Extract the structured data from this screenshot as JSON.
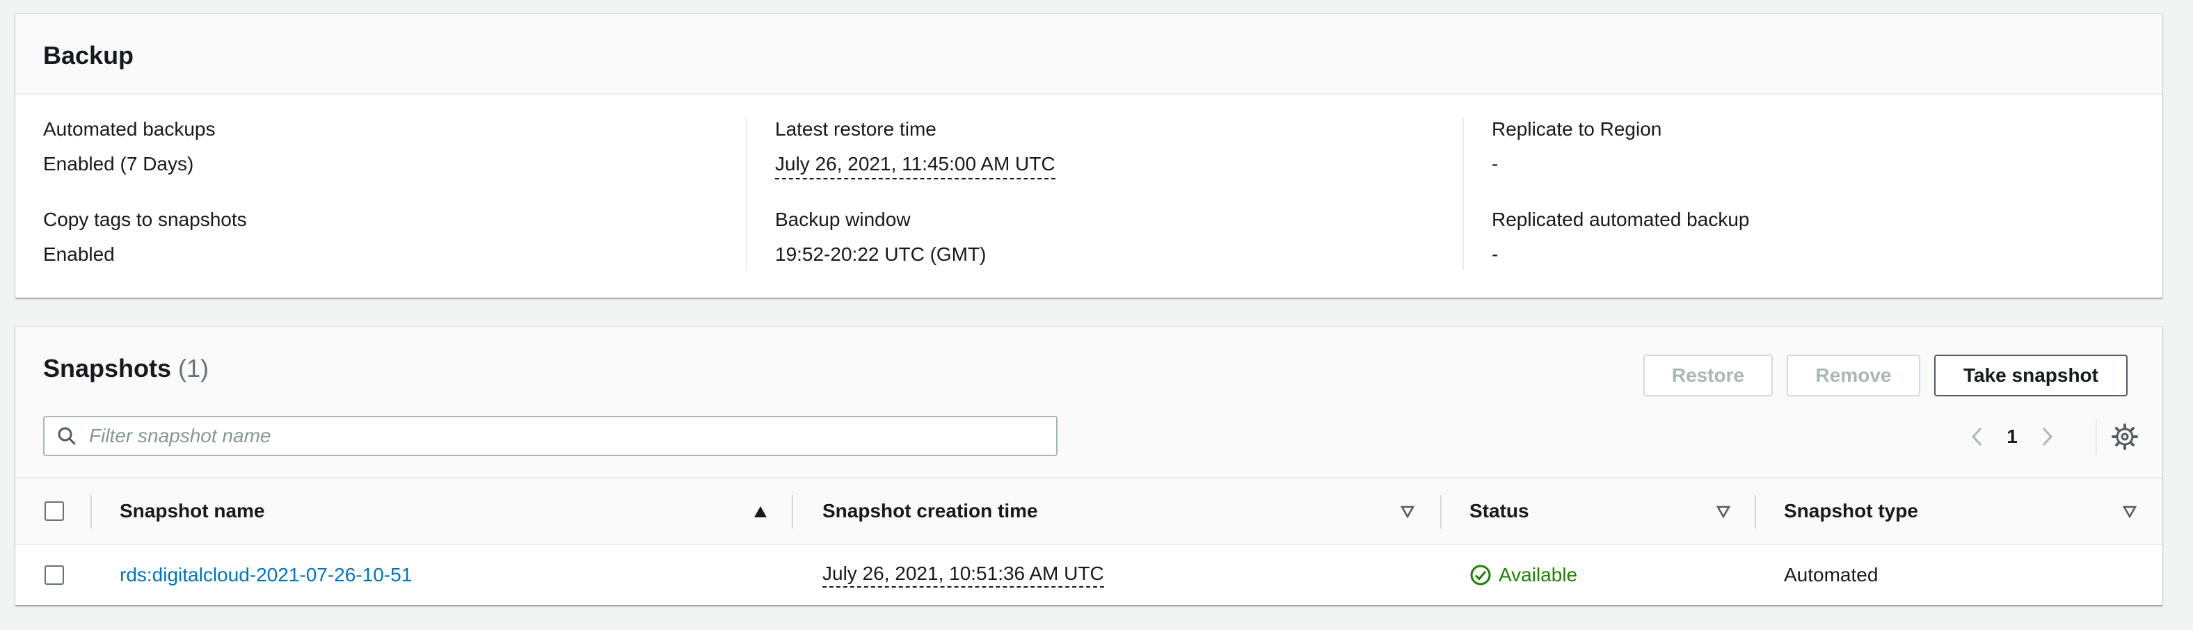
{
  "backup": {
    "title": "Backup",
    "col1": {
      "automated_label": "Automated backups",
      "automated_value": "Enabled (7 Days)",
      "copy_tags_label": "Copy tags to snapshots",
      "copy_tags_value": "Enabled"
    },
    "col2": {
      "latest_restore_label": "Latest restore time",
      "latest_restore_value": "July 26, 2021, 11:45:00 AM UTC",
      "window_label": "Backup window",
      "window_value": "19:52-20:22 UTC (GMT)"
    },
    "col3": {
      "replicate_label": "Replicate to Region",
      "replicate_value": "-",
      "replicated_label": "Replicated automated backup",
      "replicated_value": "-"
    }
  },
  "snapshots": {
    "title": "Snapshots",
    "count": "(1)",
    "buttons": {
      "restore": "Restore",
      "remove": "Remove",
      "take": "Take snapshot"
    },
    "search": {
      "placeholder": "Filter snapshot name",
      "value": ""
    },
    "pager": {
      "current_page": "1"
    },
    "columns": [
      "Snapshot name",
      "Snapshot creation time",
      "Status",
      "Snapshot type"
    ],
    "rows": [
      {
        "name": "rds:digitalcloud-2021-07-26-10-51",
        "created": "July 26, 2021, 10:51:36 AM UTC",
        "status": "Available",
        "type": "Automated"
      }
    ]
  },
  "icons": {
    "search": "search-icon",
    "prev": "chevron-left-icon",
    "next": "chevron-right-icon",
    "settings": "gear-icon",
    "sort_asc": "caret-up-icon",
    "sort_none": "caret-down-outline-icon",
    "status_ok": "check-circle-icon"
  },
  "colors": {
    "link": "#0073bb",
    "success": "#1d8102",
    "disabled_text": "#aab7b8",
    "primary_border": "#545b64"
  }
}
